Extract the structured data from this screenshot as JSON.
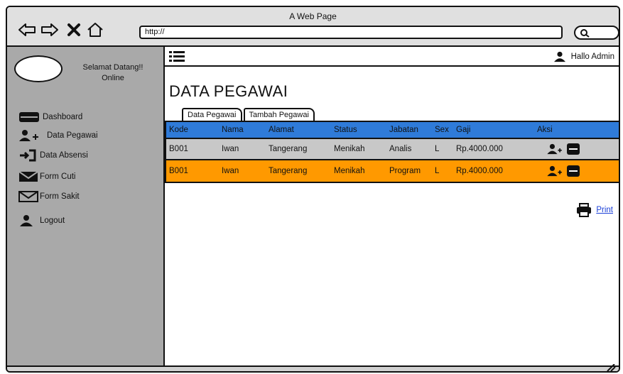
{
  "window": {
    "title": "A Web Page"
  },
  "browser": {
    "url": "http://"
  },
  "sidebar": {
    "welcome": "Selamat Datang!!",
    "status": "Online",
    "items": [
      {
        "label": "Dashboard",
        "icon": "dashboard-icon"
      },
      {
        "label": "Data Pegawai",
        "icon": "add-user-icon"
      },
      {
        "label": "Data Absensi",
        "icon": "sign-in-icon"
      },
      {
        "label": "Form Cuti",
        "icon": "envelope-filled-icon"
      },
      {
        "label": "Form Sakit",
        "icon": "envelope-outline-icon"
      },
      {
        "label": "Logout",
        "icon": "user-icon"
      }
    ]
  },
  "header": {
    "greeting": "Hallo Admin"
  },
  "main": {
    "title": "DATA PEGAWAI",
    "tabs": [
      {
        "label": "Data Pegawai"
      },
      {
        "label": "Tambah Pegawai"
      }
    ],
    "columns": [
      "Kode",
      "Nama",
      "Alamat",
      "Status",
      "Jabatan",
      "Sex",
      "Gaji",
      "Aksi"
    ],
    "rows": [
      {
        "kode": "B001",
        "nama": "Iwan",
        "alamat": "Tangerang",
        "status": "Menikah",
        "jabatan": "Analis",
        "sex": "L",
        "gaji": "Rp.4000.000"
      },
      {
        "kode": "B001",
        "nama": "Iwan",
        "alamat": "Tangerang",
        "status": "Menikah",
        "jabatan": "Program",
        "sex": "L",
        "gaji": "Rp.4000.000"
      }
    ],
    "print_label": "Print"
  },
  "colors": {
    "header_row": "#2f7bd9",
    "row_gray": "#c8c8c8",
    "row_orange": "#ff9900",
    "sidebar": "#a9a9a9",
    "link": "#1a3fd8"
  }
}
